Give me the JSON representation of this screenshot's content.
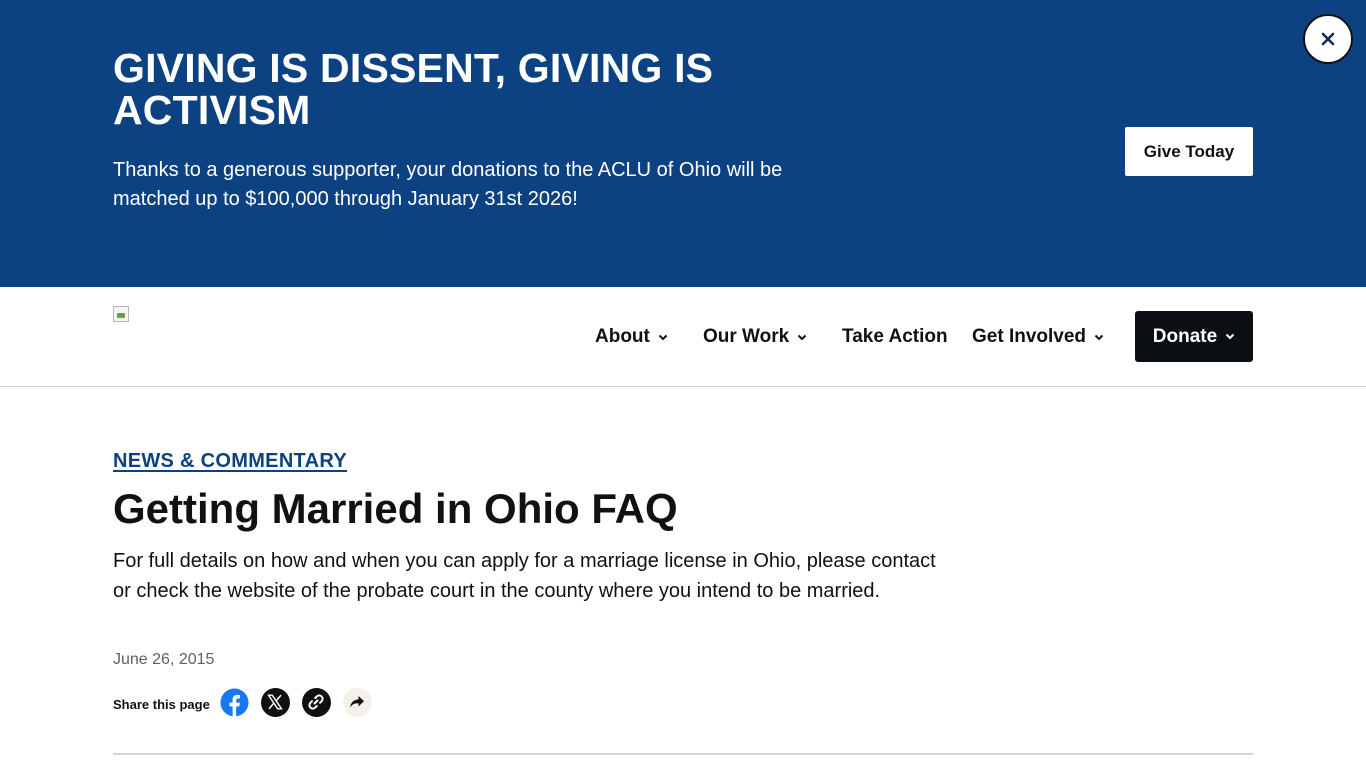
{
  "banner": {
    "heading": "GIVING IS DISSENT, GIVING IS ACTIVISM",
    "body": "Thanks to a generous supporter, your donations to the ACLU of Ohio will be matched up to $100,000 through January 31st 2026!",
    "cta_label": "Give Today",
    "close_icon": "close-icon",
    "background_color": "#0d4282"
  },
  "nav": {
    "items": [
      {
        "label": "About",
        "has_dropdown": true
      },
      {
        "label": "Our Work",
        "has_dropdown": true
      },
      {
        "label": "Take Action",
        "has_dropdown": false
      },
      {
        "label": "Get Involved",
        "has_dropdown": true
      }
    ],
    "donate_label": "Donate",
    "logo_icon": "broken-image-icon"
  },
  "article": {
    "kicker": "NEWS & COMMENTARY",
    "title": "Getting Married in Ohio FAQ",
    "dek": "For full details on how and when you can apply for a marriage license in Ohio, please contact or check the website of the probate court in the county where you intend to be married.",
    "date": "June 26, 2015",
    "share_label": "Share this page",
    "share_icons": [
      "facebook-icon",
      "x-twitter-icon",
      "link-icon",
      "share-arrow-icon"
    ]
  },
  "colors": {
    "accent": "#0d4282",
    "donate_bg": "#0b0f14",
    "facebook": "#1877f2"
  }
}
